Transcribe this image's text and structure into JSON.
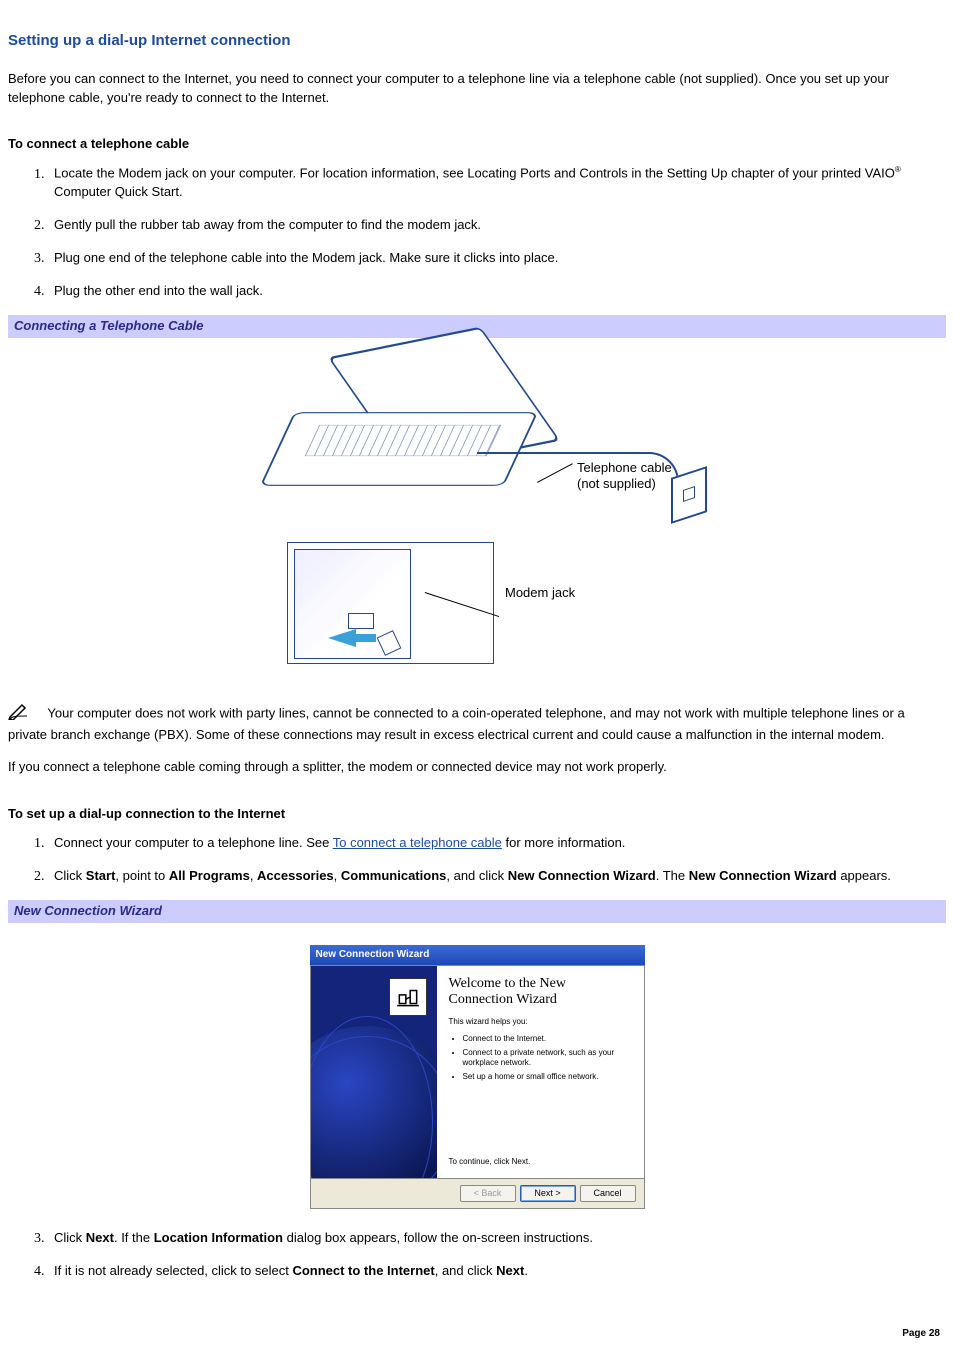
{
  "heading": "Setting up a dial-up Internet connection",
  "intro": "Before you can connect to the Internet, you need to connect your computer to a telephone line via a telephone cable (not supplied). Once you set up your telephone cable, you're ready to connect to the Internet.",
  "section1_title": "To connect a telephone cable",
  "steps1": {
    "s1a": "Locate the Modem jack on your computer. For location information, see Locating Ports and Controls in the Setting Up chapter of your printed VAIO",
    "s1b": " Computer Quick Start.",
    "s2": "Gently pull the rubber tab away from the computer to find the modem jack.",
    "s3": "Plug one end of the telephone cable into the Modem jack. Make sure it clicks into place.",
    "s4": "Plug the other end into the wall jack."
  },
  "figure1_caption": "Connecting a Telephone Cable",
  "figure1_labels": {
    "cable_line1": "Telephone cable",
    "cable_line2": "(not supplied)",
    "modem_jack": "Modem jack"
  },
  "note_text": "Your computer does not work with party lines, cannot be connected to a coin-operated telephone, and may not work with multiple telephone lines or a private branch exchange (PBX). Some of these connections may result in excess electrical current and could cause a malfunction in the internal modem.",
  "splitter_text": "If you connect a telephone cable coming through a splitter, the modem or connected device may not work properly.",
  "section2_title": "To set up a dial-up connection to the Internet",
  "steps2": {
    "s1_pre": "Connect your computer to a telephone line. See ",
    "s1_link": "To connect a telephone cable",
    "s1_post": " for more information.",
    "s2_pre": "Click ",
    "s2_start": "Start",
    "s2_a": ", point to ",
    "s2_allprograms": "All Programs",
    "s2_b": ", ",
    "s2_accessories": "Accessories",
    "s2_c": ", ",
    "s2_communications": "Communications",
    "s2_d": ", and click ",
    "s2_ncw": "New Connection Wizard",
    "s2_e": ". The ",
    "s2_ncw2": "New Connection Wizard",
    "s2_f": " appears.",
    "s3_pre": "Click ",
    "s3_next": "Next",
    "s3_mid": ". If the ",
    "s3_loc": "Location Information",
    "s3_post": " dialog box appears, follow the on-screen instructions.",
    "s4_pre": "If it is not already selected, click to select ",
    "s4_connect": "Connect to the Internet",
    "s4_mid": ", and click ",
    "s4_next": "Next",
    "s4_post": "."
  },
  "figure2_caption": "New Connection Wizard",
  "wizard": {
    "titlebar": "New Connection Wizard",
    "heading": "Welcome to the New Connection Wizard",
    "sub": "This wizard helps you:",
    "b1": "Connect to the Internet.",
    "b2": "Connect to a private network, such as your workplace network.",
    "b3": "Set up a home or small office network.",
    "continue": "To continue, click Next.",
    "back": "< Back",
    "next": "Next >",
    "cancel": "Cancel"
  },
  "page_number": "Page 28",
  "reg_mark": "®"
}
